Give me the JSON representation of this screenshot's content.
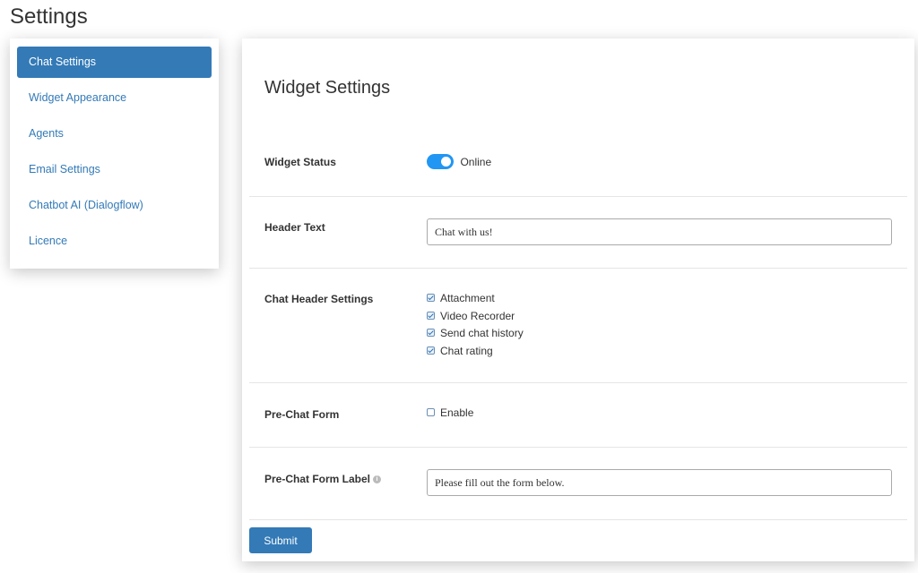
{
  "page": {
    "title": "Settings"
  },
  "sidebar": {
    "items": [
      {
        "label": "Chat Settings",
        "active": true
      },
      {
        "label": "Widget Appearance"
      },
      {
        "label": "Agents"
      },
      {
        "label": "Email Settings"
      },
      {
        "label": "Chatbot AI (Dialogflow)"
      },
      {
        "label": "Licence"
      }
    ]
  },
  "panel": {
    "title": "Widget Settings",
    "widget_status": {
      "label": "Widget Status",
      "value": "Online",
      "on": true
    },
    "header_text": {
      "label": "Header Text",
      "value": "Chat with us!"
    },
    "chat_header_settings": {
      "label": "Chat Header Settings",
      "options": [
        {
          "label": "Attachment",
          "checked": true
        },
        {
          "label": "Video Recorder",
          "checked": true
        },
        {
          "label": "Send chat history",
          "checked": true
        },
        {
          "label": "Chat rating",
          "checked": true
        }
      ]
    },
    "pre_chat_form": {
      "label": "Pre-Chat Form",
      "option": "Enable",
      "checked": false
    },
    "pre_chat_form_label": {
      "label": "Pre-Chat Form Label",
      "value": "Please fill out the form below.",
      "info_icon": "info-icon"
    },
    "submit_label": "Submit"
  },
  "colors": {
    "accent": "#337ab7",
    "toggle": "#2196f3"
  }
}
